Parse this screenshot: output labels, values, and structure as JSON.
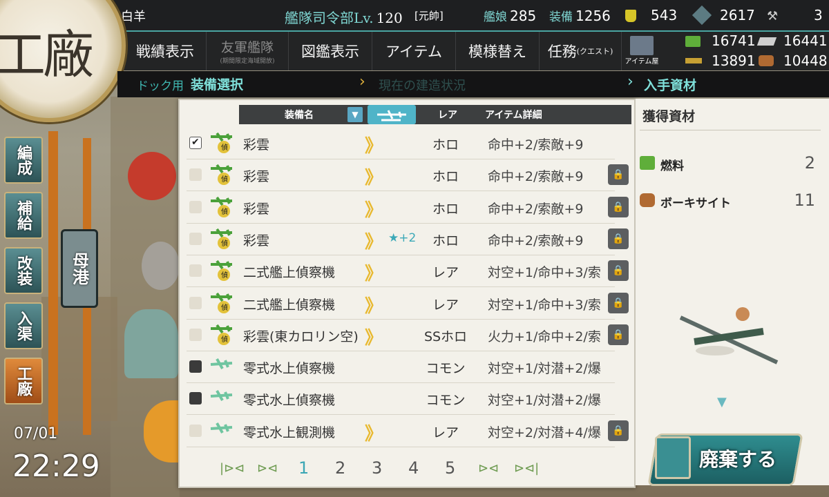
{
  "header": {
    "admiral_name": "白羊",
    "hq_label": "艦隊司令部Lv.",
    "hq_level": "120",
    "rank": "[元帥]",
    "ships_label": "艦娘",
    "ships": "285",
    "equip_label": "装備",
    "equip": "1256",
    "bucket": "543",
    "dev_material": "2617",
    "screws": "3"
  },
  "resources": {
    "fuel": "16741",
    "ammo": "16441",
    "steel": "13891",
    "bauxite": "10448"
  },
  "emblem": "工廠",
  "menu": [
    {
      "label": "戦績表示"
    },
    {
      "label": "友軍艦隊",
      "sub": "(期間限定海域開放)"
    },
    {
      "label": "図鑑表示"
    },
    {
      "label": "アイテム"
    },
    {
      "label": "模様替え"
    },
    {
      "label": "任務",
      "sub": "(クエスト)"
    }
  ],
  "item_shop_label": "アイテム屋",
  "subheader": {
    "dock": "ドック用",
    "select": "装備選択",
    "status": "現在の建造状況",
    "get": "入手資材"
  },
  "nav": [
    "編成",
    "補給",
    "改装",
    "入渠",
    "工廠"
  ],
  "port_label": "母港",
  "table": {
    "col_name": "装備名",
    "col_rare": "レア",
    "col_detail": "アイテム詳細",
    "rows": [
      {
        "name": "彩雲",
        "rare": "ホロ",
        "detail": "命中+2/索敵+9",
        "checked": "on",
        "improve": "",
        "type": "green",
        "lock": false
      },
      {
        "name": "彩雲",
        "rare": "ホロ",
        "detail": "命中+2/索敵+9",
        "checked": "off",
        "improve": "",
        "type": "green",
        "lock": true
      },
      {
        "name": "彩雲",
        "rare": "ホロ",
        "detail": "命中+2/索敵+9",
        "checked": "off",
        "improve": "",
        "type": "green",
        "lock": true
      },
      {
        "name": "彩雲",
        "rare": "ホロ",
        "detail": "命中+2/索敵+9",
        "checked": "off",
        "improve": "★+2",
        "type": "green",
        "lock": true
      },
      {
        "name": "二式艦上偵察機",
        "rare": "レア",
        "detail": "対空+1/命中+3/索",
        "checked": "off",
        "improve": "",
        "type": "green",
        "lock": true
      },
      {
        "name": "二式艦上偵察機",
        "rare": "レア",
        "detail": "対空+1/命中+3/索",
        "checked": "off",
        "improve": "",
        "type": "green",
        "lock": true
      },
      {
        "name": "彩雲(東カロリン空)",
        "rare": "SSホロ",
        "detail": "火力+1/命中+2/索",
        "checked": "off",
        "improve": "",
        "type": "green",
        "lock": true
      },
      {
        "name": "零式水上偵察機",
        "rare": "コモン",
        "detail": "対空+1/対潜+2/爆",
        "checked": "dark",
        "improve": "",
        "type": "seaplane",
        "lock": false
      },
      {
        "name": "零式水上偵察機",
        "rare": "コモン",
        "detail": "対空+1/対潜+2/爆",
        "checked": "dark",
        "improve": "",
        "type": "seaplane",
        "lock": false
      },
      {
        "name": "零式水上観測機",
        "rare": "レア",
        "detail": "対空+2/対潜+4/爆",
        "checked": "off",
        "improve": "",
        "type": "seaplane",
        "lock": true
      }
    ]
  },
  "pager": {
    "pages": [
      "1",
      "2",
      "3",
      "4",
      "5"
    ],
    "current": "1"
  },
  "right": {
    "title": "獲得資材",
    "items": [
      {
        "label": "燃料",
        "value": "2"
      },
      {
        "label": "ボーキサイト",
        "value": "11"
      }
    ],
    "scrap_label": "廃棄する"
  },
  "clock": {
    "date": "07/01",
    "time": "22:29"
  },
  "colors": {
    "accent": "#4aa6a3",
    "prof": "#e8b930",
    "improve": "#3ca9b8"
  }
}
